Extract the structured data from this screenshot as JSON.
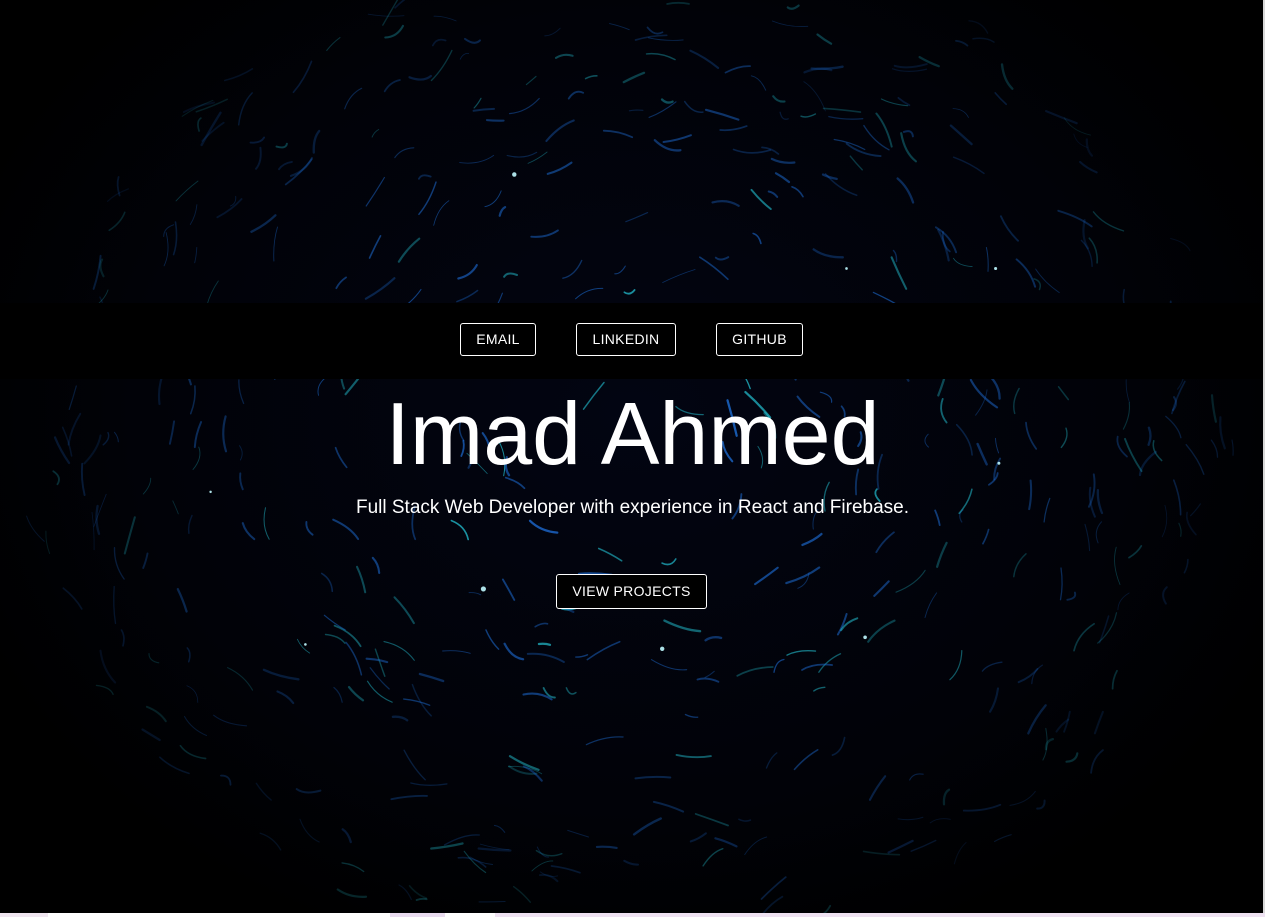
{
  "nav": {
    "email_label": "EMAIL",
    "linkedin_label": "LINKEDIN",
    "github_label": "GITHUB"
  },
  "hero": {
    "name": "Imad Ahmed",
    "tagline": "Full Stack Web Developer with experience in React and Firebase.",
    "cta_label": "VIEW PROJECTS"
  },
  "colors": {
    "background": "#000000",
    "text": "#ffffff",
    "streak_blue": "#1e6fd9",
    "streak_cyan": "#27d4e6"
  }
}
